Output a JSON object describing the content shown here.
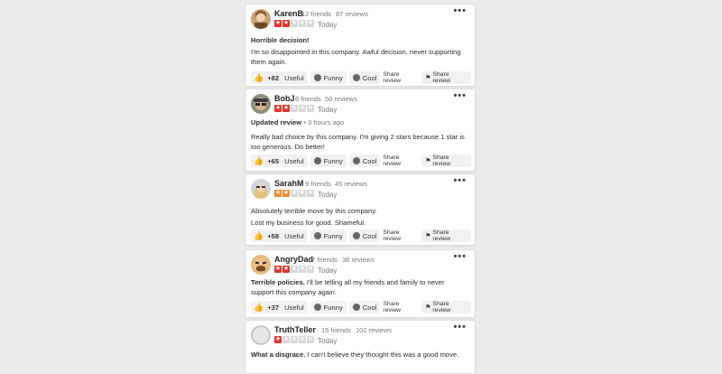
{
  "reviews": [
    {
      "name": "KarenB",
      "friends": "12 friends",
      "review_count": "87 reviews",
      "rating": 2,
      "date": "Today",
      "updated_label": "",
      "updated_ago": "",
      "title": "Horrible decision!",
      "body": "I'm so disappointed in this company. Awful decision, never supporting them again.",
      "useful_count": "+82"
    },
    {
      "name": "BobJ",
      "friends": "6 friends",
      "review_count": "50 reviews",
      "rating": 2,
      "date": "Today",
      "updated_label": "Updated review",
      "updated_ago": "• 3 hours ago",
      "title": "",
      "body": "Really bad choice by this company. I'm giving 2 stars because 1 star is too generous. Do better!",
      "useful_count": "+65"
    },
    {
      "name": "SarahM",
      "friends": "9 friends",
      "review_count": "45 reviews",
      "rating": 2,
      "date": "Today",
      "updated_label": "",
      "updated_ago": "",
      "title": "Absolutely terrible move by this company.",
      "body": "Lost my business for good. Shameful.",
      "useful_count": "+58"
    },
    {
      "name": "AngryDad",
      "friends": "7 friends",
      "review_count": "38 reviews",
      "rating": 2,
      "date": "Today",
      "updated_label": "",
      "updated_ago": "",
      "title": "Terrible policies.",
      "body": "I'll be telling all my friends and family to never support this company again.",
      "useful_count": "+37"
    },
    {
      "name": "TruthTeller",
      "friends": "15 friends",
      "review_count": "102 reviews",
      "rating": 1,
      "date": "Today",
      "updated_label": "",
      "updated_ago": "",
      "title": "What a disgrace.",
      "body": "I can't believe they thought this was a good move.",
      "useful_count": ""
    }
  ],
  "labels": {
    "useful": "Useful",
    "funny": "Funny",
    "cool": "Cool",
    "share_review": "Share review",
    "more": "•••"
  },
  "colors": {
    "star_red": "#e0332a",
    "star_orange": "#ef8a2b",
    "thumb": "#d7261f"
  }
}
